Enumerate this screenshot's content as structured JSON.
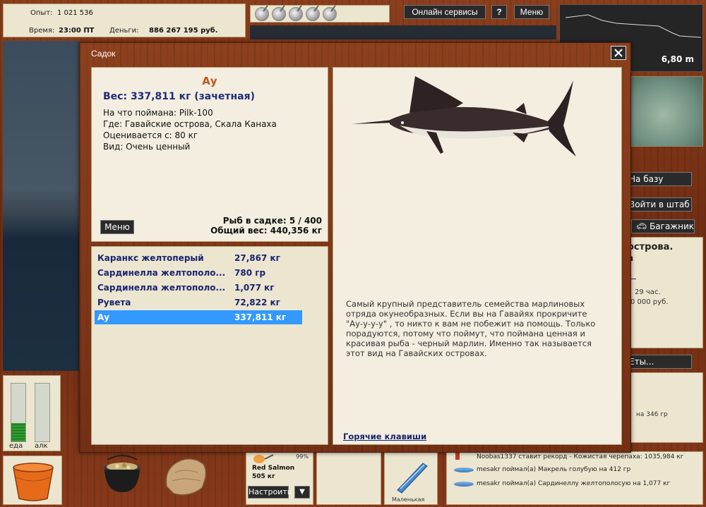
{
  "stats": {
    "exp_label": "Опыт:",
    "exp_value": "1 021 536",
    "time_label": "Время:",
    "time_value": "23:00 ПТ",
    "money_label": "Деньги:",
    "money_value": "886 267 195 руб."
  },
  "toolbar": {
    "online_label": "Онлайн сервисы",
    "help_label": "?",
    "menu_label": "Меню"
  },
  "depth": {
    "value": "6,80 m"
  },
  "right_side": {
    "base_label": "На базу",
    "hq_label": "Войти в штаб",
    "trunk_label": "Багажник",
    "more_label": "Еты...",
    "info_title": "острова.",
    "info_sub": "а",
    "info_line1": "29 час.",
    "info_line2": "0 000 руб.",
    "chat_line1": "на 346 гр"
  },
  "dialog": {
    "title": "Садок",
    "fish_name": "Ау",
    "fish_weight": "Вес: 337,811 кг (зачетная)",
    "caught_on": "На что поймана: Pilk-100",
    "location": "Где: Гавайские острова, Скала Канаха",
    "value": "Оценивается с: 80 кг",
    "kind": "Вид: Очень ценный",
    "menu_label": "Меню",
    "fish_count": "Рыб в садке: 5 / 400",
    "total_weight": "Общий вес: 440,356 кг",
    "catches": [
      {
        "name": "Каранкс желтоперый",
        "weight": "27,867 кг"
      },
      {
        "name": "Сардинелла желтополо...",
        "weight": "780 гр"
      },
      {
        "name": "Сардинелла желтополо...",
        "weight": "1,077 кг"
      },
      {
        "name": "Рувета",
        "weight": "72,822 кг"
      },
      {
        "name": "Ау",
        "weight": "337,811 кг"
      }
    ],
    "description": "Самый крупный представитель семейства марлиновых отряда окунеобразных. Если вы на Гавайях прокричите \"Ау-у-у-у\" , то никто к вам не побежит на помощь. Только порадуются, потому что поймут, что поймана ценная и красивая рыба - черный марлин. Именно так называется этот вид на Гавайских островах.",
    "hotkeys_label": "Горячие клавиши"
  },
  "bottom": {
    "food_label": "еда",
    "alcohol_label": "алк",
    "food_level": 0.32,
    "alcohol_level": 0,
    "lure_name": "Red Salmon",
    "lure_weight": "505 кг",
    "lure_pct": "99%",
    "setup_label": "Настроить",
    "dropdown_label": "▼",
    "bait_name": "Маленькая",
    "chat": [
      "Noobas1337 ставит рекорд - Кожистая черепаха: 1035,984 кг",
      "mesakr поймал(а) Макрель голубую на 412 гр",
      "mesakr поймал(а) Сардинеллу желтополосую на 1,077 кг"
    ]
  }
}
